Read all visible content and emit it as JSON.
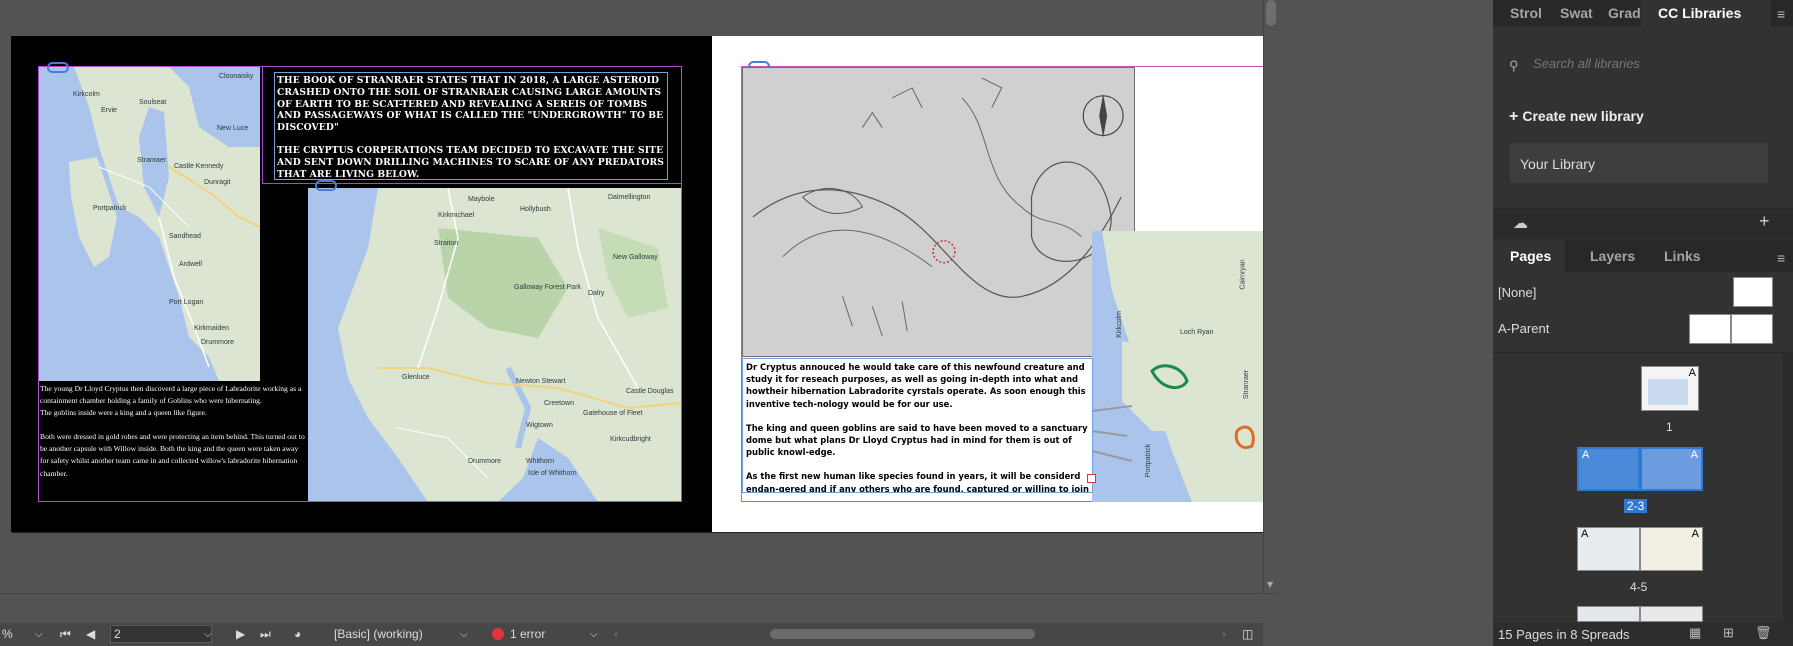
{
  "colors": {
    "accent": "#2d7ad6",
    "error": "#e5343b",
    "frame": "#b14bd6",
    "map_water": "#aac4ec",
    "map_land": "#dbe5d1"
  },
  "left_page": {
    "map1_labels": [
      "Cloonaisky",
      "Kirkcolm",
      "Ervie",
      "Soulseat",
      "Stranraer",
      "New Luce",
      "Castle Kennedy",
      "Dunragit",
      "Portpatrick",
      "Sandhead",
      "Ardwell",
      "Port Logan",
      "Kirkmaiden",
      "Drummore"
    ],
    "map2_labels": [
      "Maybole",
      "Hollybush",
      "Kirkmichael",
      "Straiton",
      "Dalmellington",
      "Galloway Forest Park",
      "Dalry",
      "Newton Stewart",
      "Creetown",
      "Wigtown",
      "Gatehouse of Fleet",
      "Whithorn",
      "Isle of Whithorn",
      "Kirkcudbright",
      "Castle Douglas",
      "New Galloway",
      "Glenluce",
      "Drummore"
    ],
    "text_top": [
      "The book of Stranraer states that in 2018, a large asteroid crashed onto the soil of Stranraer causing large amounts of earth to be scat-tered and revealing a sereis of tombs and passageways of what is called the \"Undergrowth\" to be discoved\"",
      "The Cryptus Corperations team decided to excavate the site and sent down drilling machines to scare of any predators that are living below."
    ],
    "text_bottom": [
      "The young Dr Lloyd Cryptus then discoverd a large piece of Labradorite working as a containment chamber holding a family of Goblins who were hibernating.\nThe goblins inside were a king and a queen like figure.",
      "Both were dressed in gold robes and were protecting an item behind. This turned out to be another capsule with Willow inside. Both the king and the queen were taken away for safety whilst another team came in and collected willow's labradorite hibernation chamber."
    ]
  },
  "right_page": {
    "map_labels": [
      "Loch Ryan",
      "Stranraer",
      "Cairnryan",
      "Portpatrick",
      "Kirkcolm"
    ],
    "text": [
      "Dr Cryptus annouced he would take care of this newfound creature and study it for reseach purposes, as well as going in-depth into what and howtheir hibernation Labradorite cyrstals operate. As soon enough this inventive tech-nology would be for our use.",
      "The king and queen goblins are said to have been moved to a sanctuary dome but what plans Dr Lloyd Cryptus had in mind for them is out of public knowl-edge.",
      "As the first new human like species found in years, it will be considerd endan-gered and if any others who are found, captured or willing to join us humans"
    ]
  },
  "statusbar": {
    "zoom_suffix": "%",
    "page_field": "2",
    "preflight_profile": "[Basic] (working)",
    "error_text": "1 error"
  },
  "cc_panel": {
    "tabs": [
      "Strol",
      "Swat",
      "Grad",
      "CC Libraries"
    ],
    "search_placeholder": "Search all libraries",
    "create_label": "Create new library",
    "library_name": "Your Library"
  },
  "pages_panel": {
    "tabs": [
      "Pages",
      "Layers",
      "Links"
    ],
    "parents": [
      "[None]",
      "A-Parent"
    ],
    "page_letter": "A",
    "spread_labels": [
      "1",
      "2-3",
      "4-5"
    ],
    "footer_text": "15 Pages in 8 Spreads"
  }
}
